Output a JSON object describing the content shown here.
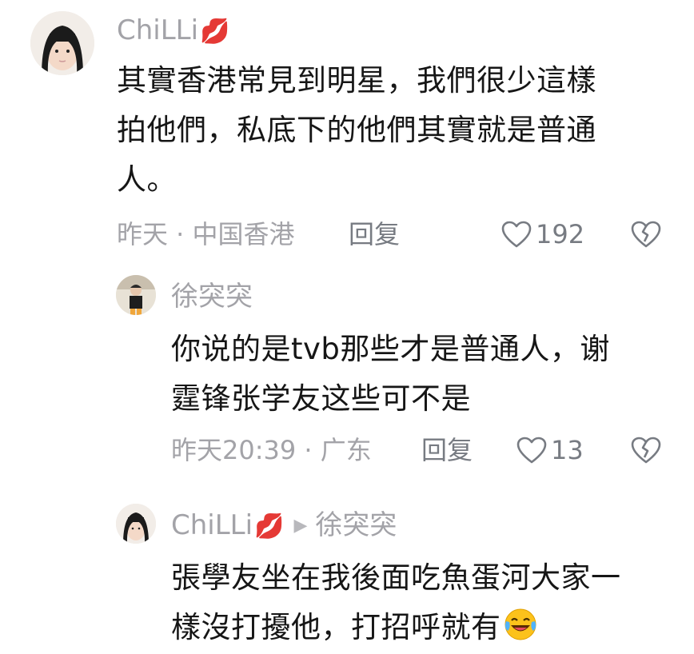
{
  "comments": [
    {
      "username": "ChiLLi",
      "username_emoji": "💋",
      "text_lines": [
        "其實香港常見到明星，我們很少這樣",
        "拍他們，私底下的他們其實就是普通",
        "人。"
      ],
      "meta": "昨天 · 中国香港",
      "reply_label": "回复",
      "like_count": "192"
    },
    {
      "username": "徐突突",
      "text_lines": [
        "你说的是tvb那些才是普通人，谢",
        "霆锋张学友这些可不是"
      ],
      "meta": "昨天20:39 · 广东",
      "reply_label": "回复",
      "like_count": "13"
    },
    {
      "username": "ChiLLi",
      "username_emoji": "💋",
      "reply_to": "徐突突",
      "text_lines": [
        "張學友坐在我後面吃魚蛋河大家一",
        "樣沒打擾他，打招呼就有"
      ],
      "trailing_emoji": "laughing-tears-emoji"
    }
  ],
  "colors": {
    "username": "#a3a3a8",
    "text": "#161616",
    "meta": "#a3a3a8",
    "action": "#777b82",
    "lips": "#f09aa8"
  }
}
